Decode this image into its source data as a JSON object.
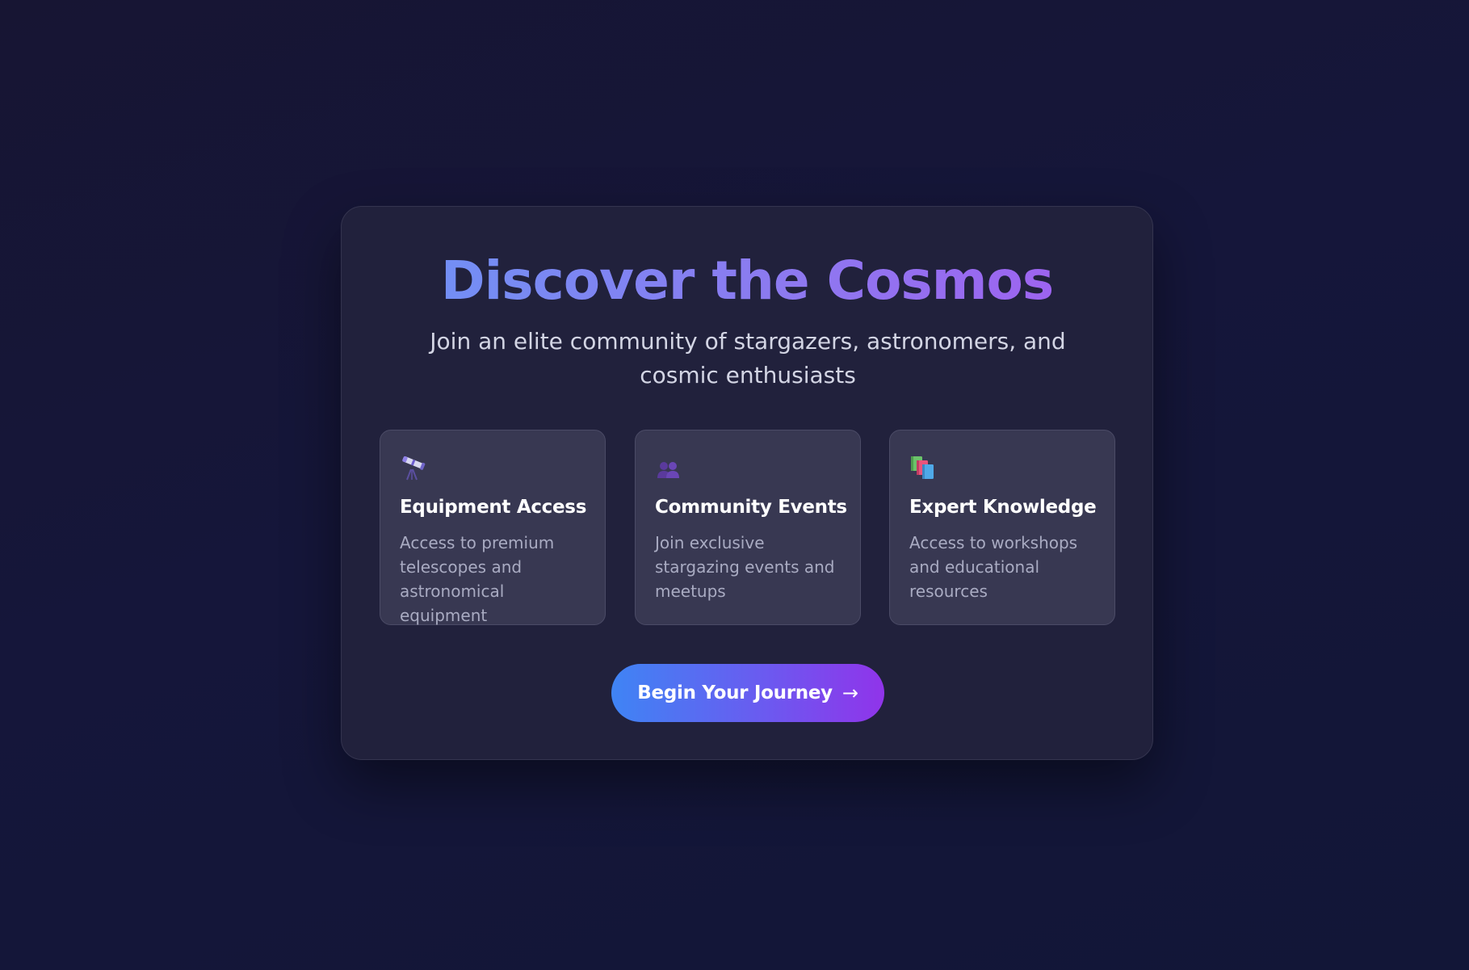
{
  "hero": {
    "title": "Discover the Cosmos",
    "subtitle": "Join an elite community of stargazers, astronomers, and cosmic enthusiasts"
  },
  "features": [
    {
      "icon": "telescope-icon",
      "title": "Equipment Access",
      "description": "Access to premium telescopes and astronomical equipment"
    },
    {
      "icon": "people-icon",
      "title": "Community Events",
      "description": "Join exclusive stargazing events and meetups"
    },
    {
      "icon": "books-icon",
      "title": "Expert Knowledge",
      "description": "Access to workshops and educational resources"
    }
  ],
  "cta": {
    "label": "Begin Your Journey",
    "arrow": "→"
  },
  "colors": {
    "background": "#161536",
    "card": "#21213c",
    "feature_card": "#383852",
    "title_gradient_start": "#6b95f5",
    "title_gradient_end": "#a35cf0",
    "button_gradient_start": "#3f84f4",
    "button_gradient_end": "#9034ea"
  }
}
